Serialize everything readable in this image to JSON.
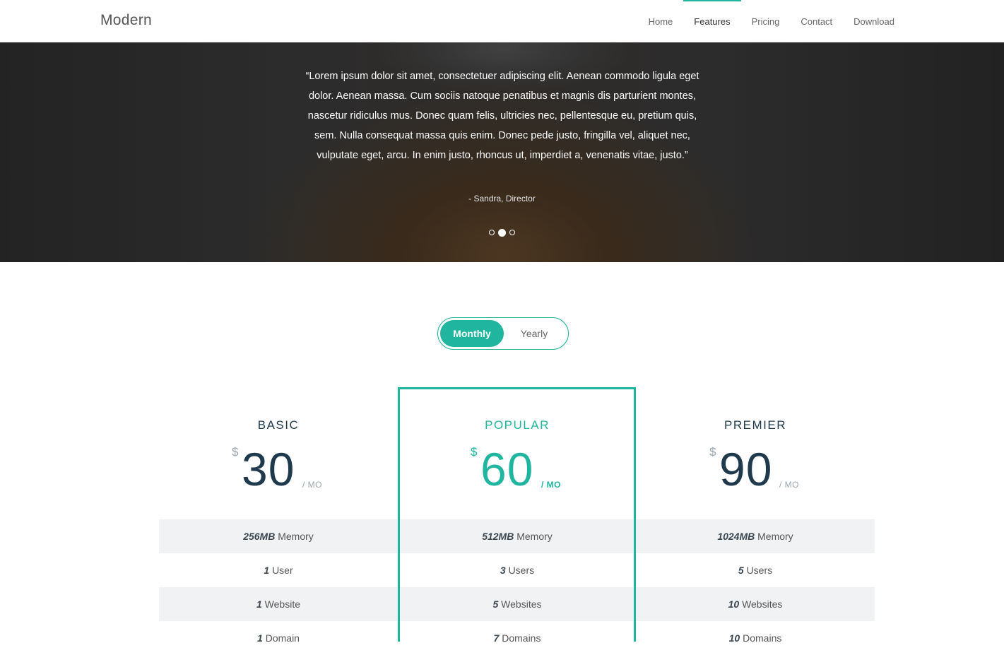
{
  "navbar": {
    "brand": "Modern",
    "items": [
      {
        "label": "Home",
        "active": false
      },
      {
        "label": "Features",
        "active": true
      },
      {
        "label": "Pricing",
        "active": false
      },
      {
        "label": "Contact",
        "active": false
      },
      {
        "label": "Download",
        "active": false
      }
    ]
  },
  "testimonial": {
    "quote": "“Lorem ipsum dolor sit amet, consectetuer adipiscing elit. Aenean commodo ligula eget dolor. Aenean massa. Cum sociis natoque penatibus et magnis dis parturient montes, nascetur ridiculus mus. Donec quam felis, ultricies nec, pellentesque eu, pretium quis, sem. Nulla consequat massa quis enim. Donec pede justo, fringilla vel, aliquet nec, vulputate eget, arcu. In enim justo, rhoncus ut, imperdiet a, venenatis vitae, justo.”",
    "author": "- Sandra, Director",
    "slide_count": 3,
    "active_slide": 2
  },
  "billing_toggle": {
    "monthly_label": "Monthly",
    "yearly_label": "Yearly",
    "selected": "Monthly"
  },
  "colors": {
    "accent": "#1fb59e",
    "heading": "#1e3a4c",
    "muted": "#9aa7b0"
  },
  "plans": [
    {
      "name": "BASIC",
      "currency": "$",
      "price": "30",
      "period": "/ MO",
      "features": [
        {
          "value": "256MB",
          "label": "Memory"
        },
        {
          "value": "1",
          "label": "User"
        },
        {
          "value": "1",
          "label": "Website"
        },
        {
          "value": "1",
          "label": "Domain"
        }
      ]
    },
    {
      "name": "POPULAR",
      "currency": "$",
      "price": "60",
      "period": "/ MO",
      "featured": true,
      "features": [
        {
          "value": "512MB",
          "label": "Memory"
        },
        {
          "value": "3",
          "label": "Users"
        },
        {
          "value": "5",
          "label": "Websites"
        },
        {
          "value": "7",
          "label": "Domains"
        }
      ]
    },
    {
      "name": "PREMIER",
      "currency": "$",
      "price": "90",
      "period": "/ MO",
      "features": [
        {
          "value": "1024MB",
          "label": "Memory"
        },
        {
          "value": "5",
          "label": "Users"
        },
        {
          "value": "10",
          "label": "Websites"
        },
        {
          "value": "10",
          "label": "Domains"
        }
      ]
    }
  ]
}
